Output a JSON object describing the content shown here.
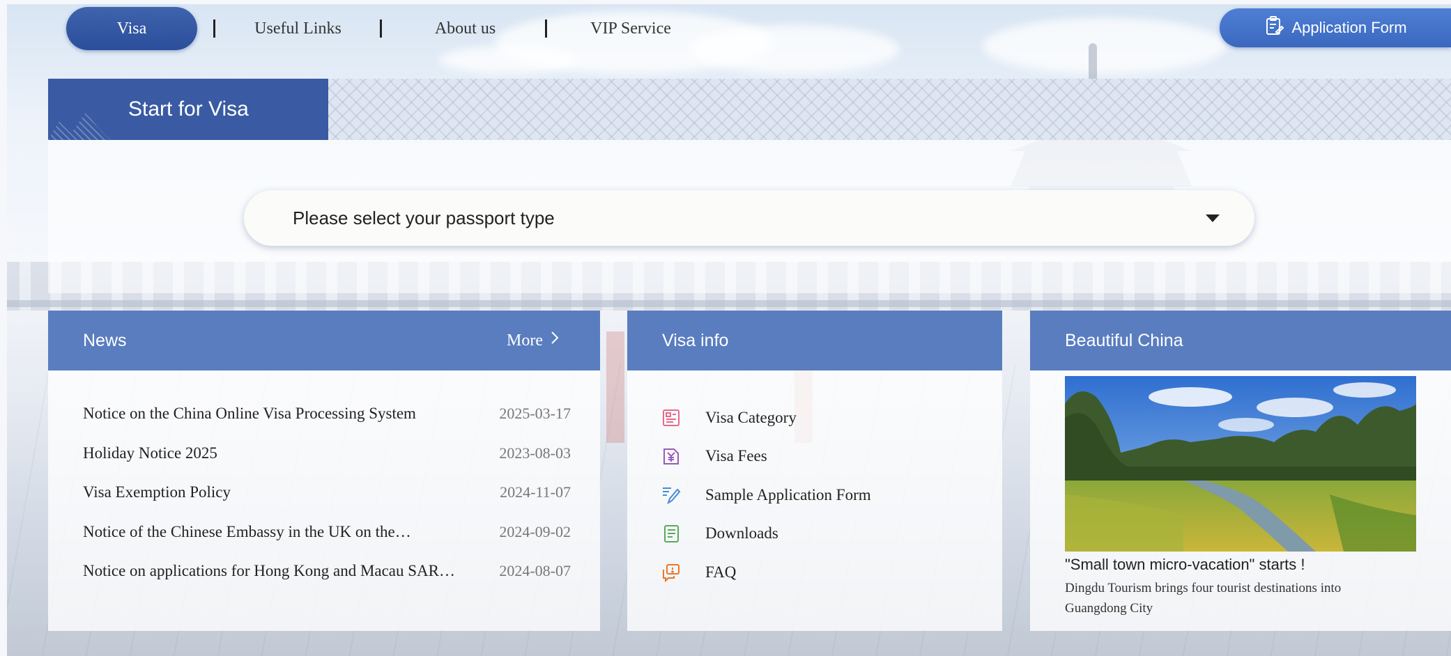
{
  "nav": {
    "items": [
      "Visa",
      "Useful Links",
      "About us",
      "VIP Service"
    ],
    "active": "Visa",
    "application_form": "Application Form"
  },
  "visa_section": {
    "title": "Start for Visa",
    "passport_placeholder": "Please select your passport type"
  },
  "news": {
    "title": "News",
    "more": "More",
    "items": [
      {
        "title": "Notice on the China Online Visa Processing System",
        "date": "2025-03-17"
      },
      {
        "title": "Holiday Notice 2025",
        "date": "2023-08-03"
      },
      {
        "title": "Visa Exemption Policy",
        "date": "2024-11-07"
      },
      {
        "title": "Notice of the Chinese Embassy in the UK on the…",
        "date": "2024-09-02"
      },
      {
        "title": "Notice on applications for Hong Kong and Macau SAR…",
        "date": "2024-08-07"
      }
    ]
  },
  "visa_info": {
    "title": "Visa info",
    "items": [
      {
        "label": "Visa Category",
        "icon": "visa-category-icon",
        "color": "#e86a8a"
      },
      {
        "label": "Visa Fees",
        "icon": "yuan-icon",
        "color": "#9a5ab8"
      },
      {
        "label": "Sample Application Form",
        "icon": "pen-edit-icon",
        "color": "#4a8ad8"
      },
      {
        "label": "Downloads",
        "icon": "document-icon",
        "color": "#5aaa5a"
      },
      {
        "label": "FAQ",
        "icon": "chat-bubbles-icon",
        "color": "#e8782a"
      }
    ]
  },
  "beautiful_china": {
    "title": "Beautiful China",
    "headline": "\"Small town micro-vacation\" starts !",
    "description": "Dingdu Tourism brings four tourist destinations into Guangdong City"
  },
  "colors": {
    "nav_active": "#2c4e9b",
    "card_header": "#5a7dc0",
    "app_button": "#3a68bf"
  }
}
